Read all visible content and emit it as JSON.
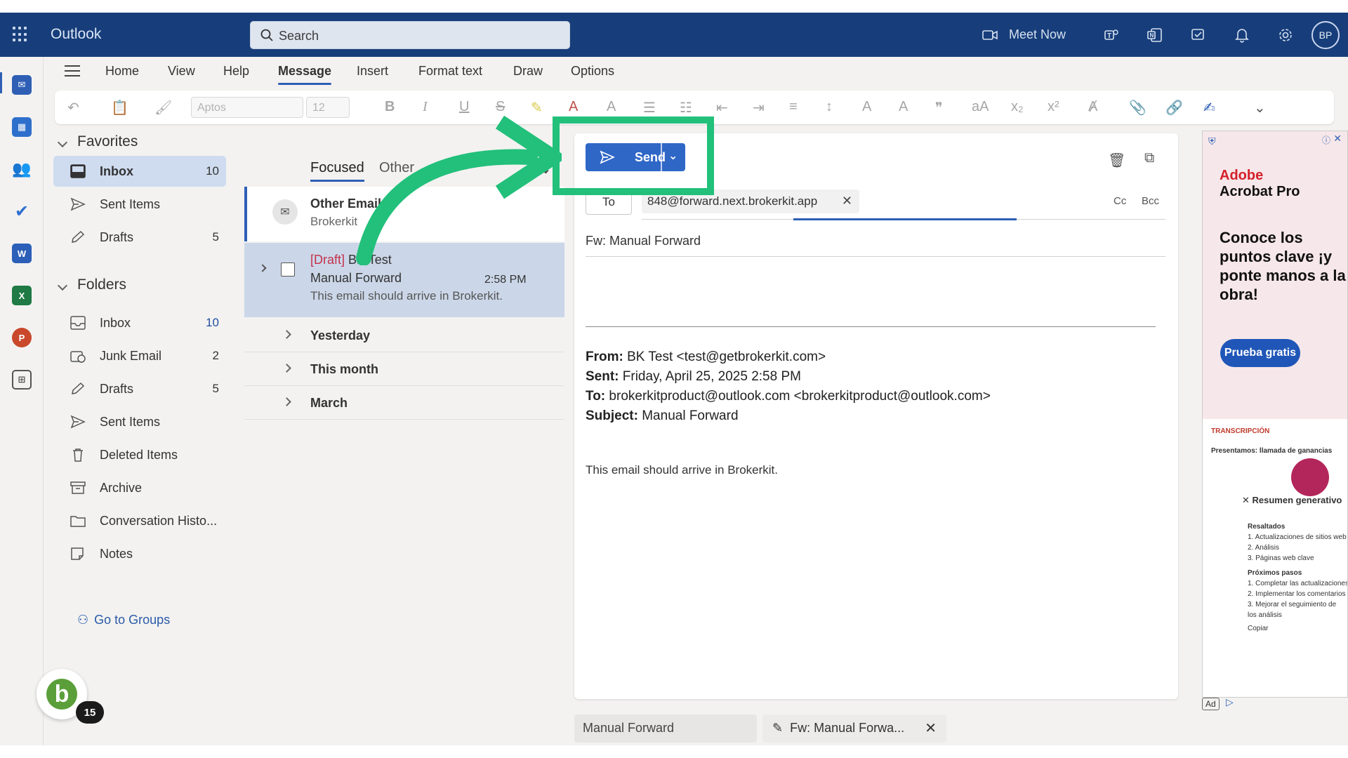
{
  "app": {
    "name": "Outlook"
  },
  "search": {
    "placeholder": "Search"
  },
  "topbar": {
    "meet_now": "Meet Now",
    "avatar_initials": "BP"
  },
  "ribbon": {
    "tabs": [
      "Home",
      "View",
      "Help",
      "Message",
      "Insert",
      "Format text",
      "Draw",
      "Options"
    ],
    "active_tab": "Message",
    "font_name": "Aptos",
    "font_size": "12"
  },
  "folders": {
    "favorites_title": "Favorites",
    "favorites": [
      {
        "label": "Inbox",
        "count": "10"
      },
      {
        "label": "Sent Items",
        "count": ""
      },
      {
        "label": "Drafts",
        "count": "5"
      }
    ],
    "folders_title": "Folders",
    "items": [
      {
        "label": "Inbox",
        "count": "10"
      },
      {
        "label": "Junk Email",
        "count": "2"
      },
      {
        "label": "Drafts",
        "count": "5"
      },
      {
        "label": "Sent Items",
        "count": ""
      },
      {
        "label": "Deleted Items",
        "count": ""
      },
      {
        "label": "Archive",
        "count": ""
      },
      {
        "label": "Conversation Histo...",
        "count": ""
      },
      {
        "label": "Notes",
        "count": ""
      }
    ],
    "go_to_groups": "Go to Groups"
  },
  "brokerkit": {
    "badge_count": "15",
    "logo_letter": "b"
  },
  "message_list": {
    "tab_focused": "Focused",
    "tab_other": "Other",
    "other_emails": {
      "title": "Other Emails",
      "subtitle": "Brokerkit"
    },
    "draft": {
      "draft_tag": "[Draft]",
      "sender": "BK Test",
      "subject": "Manual Forward",
      "time": "2:58 PM",
      "preview": "This email should arrive in Brokerkit."
    },
    "groups": [
      "Yesterday",
      "This month",
      "March"
    ]
  },
  "compose": {
    "send_label": "Send",
    "to_label": "To",
    "recipient": "848@forward.next.brokerkit.app",
    "cc": "Cc",
    "bcc": "Bcc",
    "subject": "Fw: Manual Forward",
    "from_label": "From:",
    "from_value": "BK Test <test@getbrokerkit.com>",
    "sent_label": "Sent:",
    "sent_value": "Friday, April 25, 2025 2:58 PM",
    "to_hdr_label": "To:",
    "to_hdr_value": "brokerkitproduct@outlook.com <brokerkitproduct@outlook.com>",
    "subject_label": "Subject:",
    "subject_value": "Manual Forward",
    "body": "This email should arrive in Brokerkit."
  },
  "bottom_tabs": {
    "tab1": "Manual Forward",
    "tab2": "Fw: Manual Forwa..."
  },
  "ad": {
    "brand_line1": "Adobe",
    "brand_line2": "Acrobat Pro",
    "headline": "Conoce los puntos clave ¡y ponte manos a la obra!",
    "cta": "Prueba gratis",
    "doc_label": "TRANSCRIPCIÓN",
    "doc_title": "Presentamos: llamada de ganancias",
    "gen_summary": "✕ Resumen generativo",
    "highlights_title": "Resaltados",
    "highlights": [
      "1. Actualizaciones de sitios web",
      "2. Análisis",
      "3. Páginas web clave"
    ],
    "next_title": "Próximos pasos",
    "next": [
      "1. Completar las actualizaciones",
      "2. Implementar los comentarios",
      "3. Mejorar el seguimiento de",
      "los análisis"
    ],
    "copy": "Copiar",
    "ad_tag": "Ad"
  },
  "colors": {
    "brand_bar": "#173e7a",
    "accent": "#2f67c7",
    "highlight_box": "#22c07a",
    "draft_tag": "#c4314b"
  }
}
